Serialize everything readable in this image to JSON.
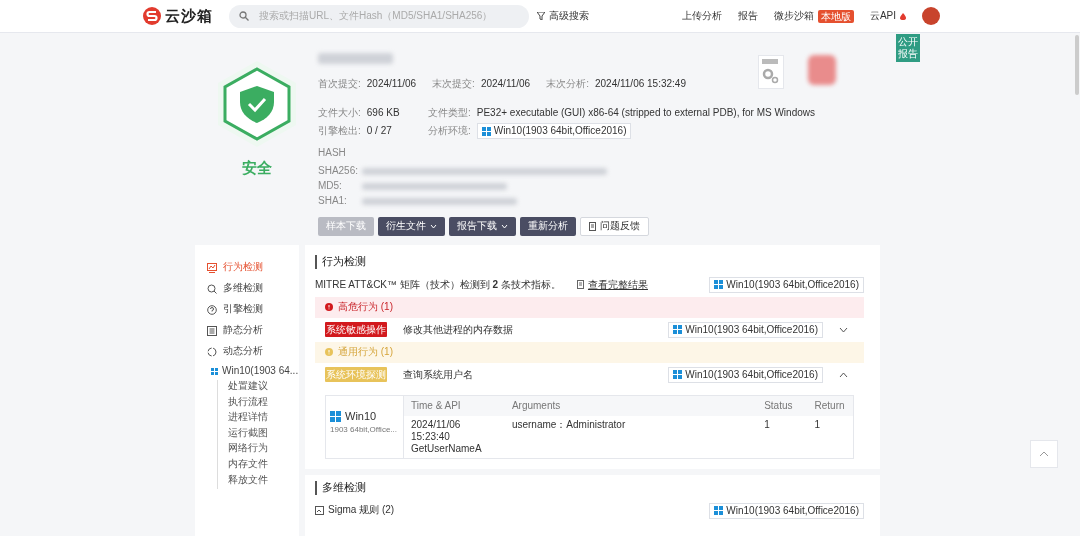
{
  "header": {
    "logo_text": "云沙箱",
    "search": {
      "placeholder": "搜索或扫描URL、文件Hash（MD5/SHA1/SHA256）"
    },
    "advanced_search": "高级搜索",
    "nav": [
      {
        "label": "上传分析"
      },
      {
        "label": "报告"
      },
      {
        "label": "微步沙箱",
        "badge": "本地版"
      },
      {
        "label": "云API"
      }
    ]
  },
  "side_tag": "公开报告",
  "verdict": "安全",
  "info": {
    "dates": [
      {
        "label": "首次提交:",
        "value": "2024/11/06"
      },
      {
        "label": "末次提交:",
        "value": "2024/11/06"
      },
      {
        "label": "末次分析:",
        "value": "2024/11/06 15:32:49"
      }
    ],
    "size": {
      "label": "文件大小:",
      "value": "696 KB"
    },
    "type": {
      "label": "文件类型:",
      "value": "PE32+ executable (GUI) x86-64 (stripped to external PDB), for MS Windows"
    },
    "engines": {
      "label": "引擎检出:",
      "value": "0 / 27"
    },
    "env": {
      "label": "分析环境:",
      "value": "Win10(1903 64bit,Office2016)"
    },
    "hash_title": "HASH",
    "hashes": [
      {
        "label": "SHA256:"
      },
      {
        "label": "MD5:"
      },
      {
        "label": "SHA1:"
      }
    ]
  },
  "actions": [
    {
      "label": "样本下载",
      "kind": "dark",
      "disabled": true,
      "dropdown": false
    },
    {
      "label": "衍生文件",
      "kind": "dark",
      "disabled": false,
      "dropdown": true
    },
    {
      "label": "报告下载",
      "kind": "dark",
      "disabled": false,
      "dropdown": true
    },
    {
      "label": "重新分析",
      "kind": "dark",
      "disabled": false,
      "dropdown": false
    },
    {
      "label": "问题反馈",
      "kind": "outline",
      "disabled": false,
      "dropdown": false
    }
  ],
  "sidebar": {
    "items": [
      {
        "label": "行为检测",
        "selected": true
      },
      {
        "label": "多维检测",
        "selected": false
      },
      {
        "label": "引擎检测",
        "selected": false
      },
      {
        "label": "静态分析",
        "selected": false
      },
      {
        "label": "动态分析",
        "selected": false,
        "children": [
          {
            "label": "Win10(1903 64...",
            "expanded": true,
            "children": [
              {
                "label": "处置建议"
              },
              {
                "label": "执行流程"
              },
              {
                "label": "进程详情"
              },
              {
                "label": "运行截图"
              },
              {
                "label": "网络行为"
              },
              {
                "label": "内存文件"
              },
              {
                "label": "释放文件"
              }
            ]
          }
        ]
      }
    ]
  },
  "behavior": {
    "title": "行为检测",
    "summary": "MITRE ATT&CK™ 矩阵（技术）检测到 **2** 条技术指标。",
    "link": "查看完整结果",
    "env": "Win10(1903 64bit,Office2016)",
    "groups": [
      {
        "kind": "high",
        "title": "高危行为 (1)",
        "items": [
          {
            "tag": "系统敏感操作",
            "desc": "修改其他进程的内存数据",
            "env": "Win10(1903 64bit,Office2016)",
            "expanded": false
          }
        ]
      },
      {
        "kind": "general",
        "title": "通用行为 (1)",
        "items": [
          {
            "tag": "系统环境探测",
            "desc": "查询系统用户名",
            "env": "Win10(1903 64bit,Office2016)",
            "expanded": true,
            "detail": {
              "env_title": "Win10",
              "env_sub": "1903 64bit,Office...",
              "columns": [
                "Time & API",
                "Arguments",
                "Status",
                "Return"
              ],
              "rows": [
                {
                  "time": "2024/11/06 15:23:40",
                  "api": "GetUserNameA",
                  "arguments": "username：Administrator",
                  "status": "1",
                  "return": "1"
                }
              ]
            }
          }
        ]
      }
    ]
  },
  "multi": {
    "title": "多维检测",
    "rule": "Sigma 规则 (2)",
    "env": "Win10(1903 64bit,Office2016)"
  }
}
